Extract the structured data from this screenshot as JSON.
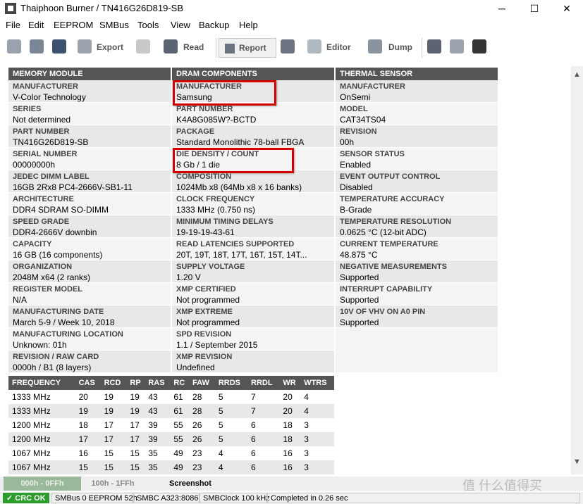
{
  "window": {
    "title": "Thaiphoon Burner / TN416G26D819-SB",
    "minimize": "─",
    "maximize": "☐",
    "close": "✕"
  },
  "menu": [
    "File",
    "Edit",
    "EEPROM",
    "SMBus",
    "Tools",
    "View",
    "Backup",
    "Help"
  ],
  "toolbar": {
    "export": "Export",
    "read": "Read",
    "report": "Report",
    "editor": "Editor",
    "dump": "Dump"
  },
  "columns": [
    {
      "header": "MEMORY MODULE",
      "rows": [
        {
          "label": "MANUFACTURER",
          "value": "V-Color Technology"
        },
        {
          "label": "SERIES",
          "value": "Not determined"
        },
        {
          "label": "PART NUMBER",
          "value": "TN416G26D819-SB"
        },
        {
          "label": "SERIAL NUMBER",
          "value": "00000000h"
        },
        {
          "label": "JEDEC DIMM LABEL",
          "value": "16GB 2Rx8 PC4-2666V-SB1-11"
        },
        {
          "label": "ARCHITECTURE",
          "value": "DDR4 SDRAM SO-DIMM"
        },
        {
          "label": "SPEED GRADE",
          "value": "DDR4-2666V downbin"
        },
        {
          "label": "CAPACITY",
          "value": "16 GB (16 components)"
        },
        {
          "label": "ORGANIZATION",
          "value": "2048M x64 (2 ranks)"
        },
        {
          "label": "REGISTER MODEL",
          "value": "N/A"
        },
        {
          "label": "MANUFACTURING DATE",
          "value": "March 5-9 / Week 10, 2018"
        },
        {
          "label": "MANUFACTURING LOCATION",
          "value": "Unknown: 01h"
        },
        {
          "label": "REVISION / RAW CARD",
          "value": "0000h / B1 (8 layers)"
        }
      ]
    },
    {
      "header": "DRAM COMPONENTS",
      "rows": [
        {
          "label": "MANUFACTURER",
          "value": "Samsung"
        },
        {
          "label": "PART NUMBER",
          "value": "K4A8G085W?-BCTD"
        },
        {
          "label": "PACKAGE",
          "value": "Standard Monolithic 78-ball FBGA"
        },
        {
          "label": "DIE DENSITY / COUNT",
          "value": "8 Gb / 1 die"
        },
        {
          "label": "COMPOSITION",
          "value": "1024Mb x8 (64Mb x8 x 16 banks)"
        },
        {
          "label": "CLOCK FREQUENCY",
          "value": "1333 MHz (0.750 ns)"
        },
        {
          "label": "MINIMUM TIMING DELAYS",
          "value": "19-19-19-43-61"
        },
        {
          "label": "READ LATENCIES SUPPORTED",
          "value": "20T, 19T, 18T, 17T, 16T, 15T, 14T..."
        },
        {
          "label": "SUPPLY VOLTAGE",
          "value": "1.20 V"
        },
        {
          "label": "XMP CERTIFIED",
          "value": "Not programmed"
        },
        {
          "label": "XMP EXTREME",
          "value": "Not programmed"
        },
        {
          "label": "SPD REVISION",
          "value": "1.1 / September 2015"
        },
        {
          "label": "XMP REVISION",
          "value": "Undefined"
        }
      ]
    },
    {
      "header": "THERMAL SENSOR",
      "rows": [
        {
          "label": "MANUFACTURER",
          "value": "OnSemi"
        },
        {
          "label": "MODEL",
          "value": "CAT34TS04"
        },
        {
          "label": "REVISION",
          "value": "00h"
        },
        {
          "label": "SENSOR STATUS",
          "value": "Enabled"
        },
        {
          "label": "EVENT OUTPUT CONTROL",
          "value": "Disabled"
        },
        {
          "label": "TEMPERATURE ACCURACY",
          "value": "B-Grade"
        },
        {
          "label": "TEMPERATURE RESOLUTION",
          "value": "0.0625 °C (12-bit ADC)"
        },
        {
          "label": "CURRENT TEMPERATURE",
          "value": "48.875 °C"
        },
        {
          "label": "NEGATIVE MEASUREMENTS",
          "value": "Supported"
        },
        {
          "label": "INTERRUPT CAPABILITY",
          "value": "Supported"
        },
        {
          "label": "10V OF VHV ON A0 PIN",
          "value": "Supported"
        }
      ]
    }
  ],
  "timings": {
    "headers": [
      "FREQUENCY",
      "CAS",
      "RCD",
      "RP",
      "RAS",
      "RC",
      "FAW",
      "RRDS",
      "RRDL",
      "WR",
      "WTRS"
    ],
    "rows": [
      [
        "1333 MHz",
        "20",
        "19",
        "19",
        "43",
        "61",
        "28",
        "5",
        "7",
        "20",
        "4"
      ],
      [
        "1333 MHz",
        "19",
        "19",
        "19",
        "43",
        "61",
        "28",
        "5",
        "7",
        "20",
        "4"
      ],
      [
        "1200 MHz",
        "18",
        "17",
        "17",
        "39",
        "55",
        "26",
        "5",
        "6",
        "18",
        "3"
      ],
      [
        "1200 MHz",
        "17",
        "17",
        "17",
        "39",
        "55",
        "26",
        "5",
        "6",
        "18",
        "3"
      ],
      [
        "1067 MHz",
        "16",
        "15",
        "15",
        "35",
        "49",
        "23",
        "4",
        "6",
        "16",
        "3"
      ],
      [
        "1067 MHz",
        "15",
        "15",
        "15",
        "35",
        "49",
        "23",
        "4",
        "6",
        "16",
        "3"
      ]
    ]
  },
  "tabs": [
    "000h - 0FFh",
    "100h - 1FFh",
    "Screenshot"
  ],
  "status": {
    "crc": "✓ CRC OK",
    "smbus": "SMBus 0 EEPROM 52h",
    "smbc": "SMBC A323:8086",
    "clock": "SMBClock 100 kHz",
    "completed": "Completed in 0.26 sec"
  },
  "watermark": "值 什么值得买",
  "colors": {
    "header_bg": "#555555",
    "highlight": "#d40000",
    "crc_bg": "#2d9b2d"
  }
}
